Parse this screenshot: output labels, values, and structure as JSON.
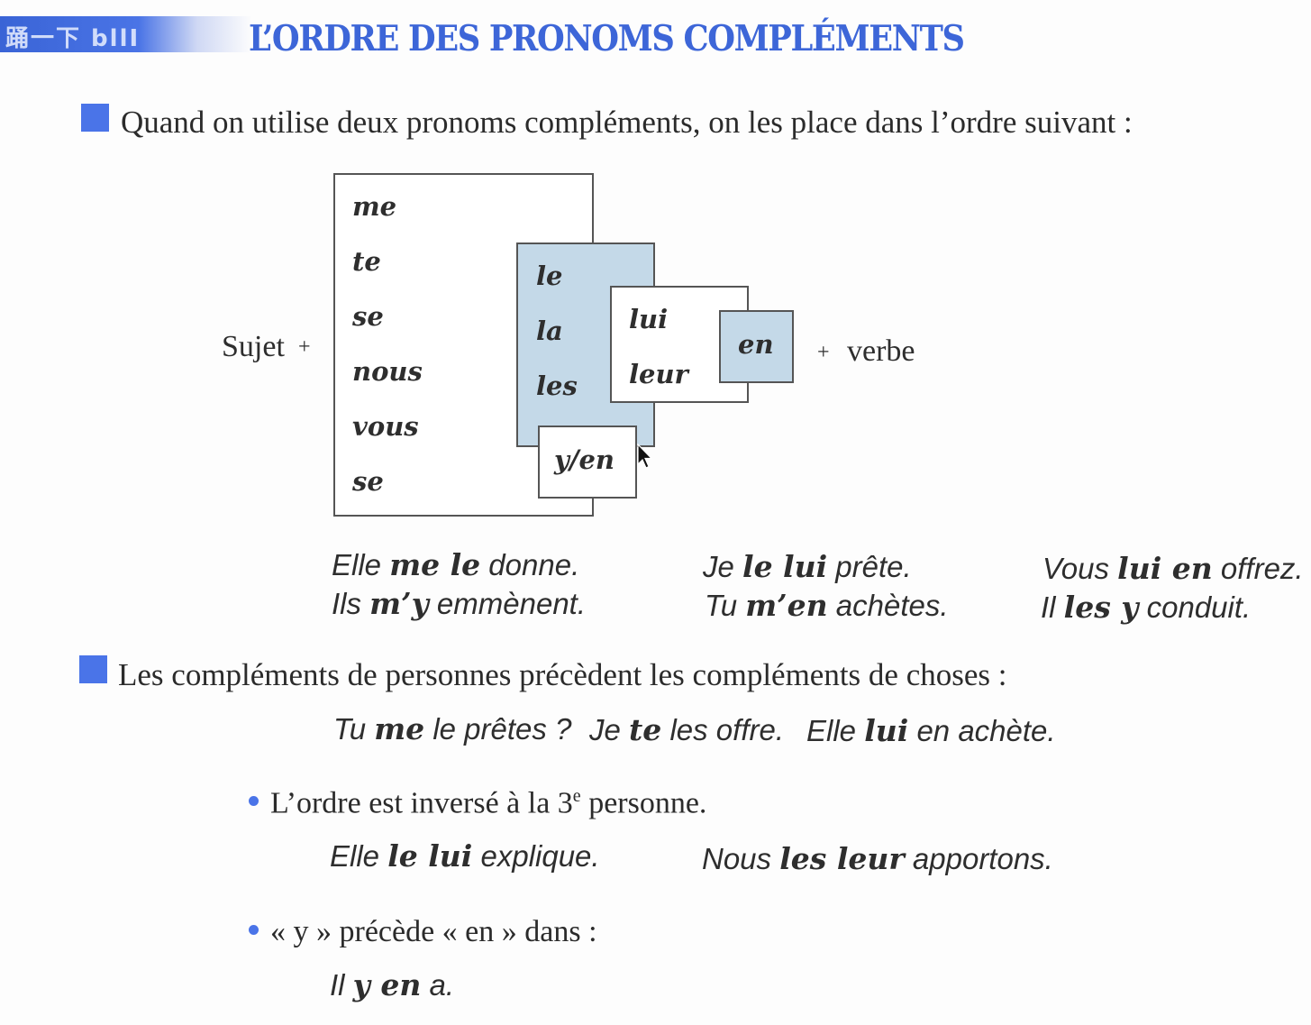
{
  "header": {
    "tab_label": "踊一下 bllI",
    "title": "L’ORDRE DES PRONOMS COMPLÉMENTS"
  },
  "rule1": {
    "text": "Quand on utilise deux pronoms compléments, on les place dans l’ordre suivant :"
  },
  "diagram": {
    "subject_label": "Sujet",
    "plus": "+",
    "verb_label": "verbe",
    "group1": [
      "me",
      "te",
      "se",
      "nous",
      "vous",
      "se"
    ],
    "group2": [
      "le",
      "la",
      "les"
    ],
    "group3": [
      "lui",
      "leur"
    ],
    "group4": "en",
    "group5": "y/en",
    "colors": {
      "blue_box": "#c4d9e8",
      "border": "#555555"
    }
  },
  "examples1": [
    [
      "Elle ",
      "me le",
      " donne."
    ],
    [
      "Ils ",
      "m’y",
      " emmènent."
    ],
    [
      "Je ",
      "le lui",
      " prête."
    ],
    [
      "Tu ",
      "m’en",
      " achètes."
    ],
    [
      "Vous ",
      "lui en",
      " offrez."
    ],
    [
      "Il ",
      "les y",
      " conduit."
    ]
  ],
  "rule2": {
    "text": "Les compléments de personnes précèdent les compléments de choses :"
  },
  "examples2": [
    [
      "Tu ",
      "me",
      " le prêtes ?"
    ],
    [
      "Je ",
      "te",
      " les offre."
    ],
    [
      "Elle ",
      "lui",
      " en achète."
    ]
  ],
  "bullet1": {
    "text_a": "L’ordre est inversé à la 3",
    "sup": "e",
    "text_b": " personne."
  },
  "examples3": [
    [
      "Elle ",
      "le lui",
      " explique."
    ],
    [
      "Nous ",
      "les leur",
      " apportons."
    ]
  ],
  "bullet2": {
    "text": "« y » précède « en » dans :"
  },
  "examples4": [
    [
      "Il ",
      "y en",
      " a."
    ]
  ],
  "accent_color": "#4a74e8"
}
